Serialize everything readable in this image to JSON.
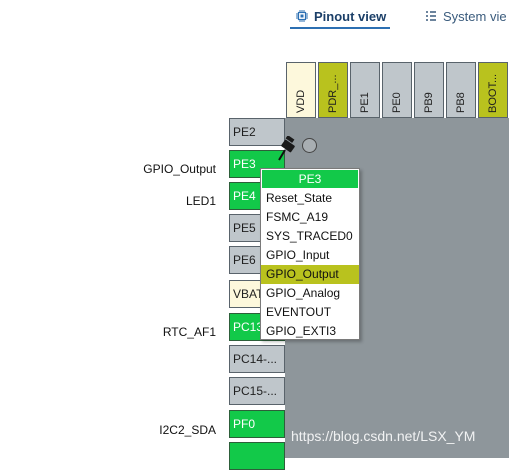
{
  "tabs": {
    "pinout": "Pinout view",
    "system": "System vie"
  },
  "top_pins": [
    {
      "label": "VDD",
      "color": "yellow"
    },
    {
      "label": "PDR_...",
      "color": "olive"
    },
    {
      "label": "PE1",
      "color": "gray"
    },
    {
      "label": "PE0",
      "color": "gray"
    },
    {
      "label": "PB9",
      "color": "gray"
    },
    {
      "label": "PB8",
      "color": "gray"
    },
    {
      "label": "BOOT...",
      "color": "olive"
    }
  ],
  "left_pins": [
    {
      "label": "PE2",
      "color": "gray"
    },
    {
      "label": "PE3",
      "color": "green"
    },
    {
      "label": "PE4",
      "color": "green"
    },
    {
      "label": "PE5",
      "color": "gray"
    },
    {
      "label": "PE6",
      "color": "gray"
    },
    {
      "label": "VBAT",
      "color": "yellow"
    },
    {
      "label": "PC13",
      "color": "green"
    },
    {
      "label": "PC14-...",
      "color": "gray"
    },
    {
      "label": "PC15-...",
      "color": "gray"
    },
    {
      "label": "PF0",
      "color": "green"
    },
    {
      "label": "",
      "color": "green"
    }
  ],
  "signals": {
    "gpio_output": "GPIO_Output",
    "led1": "LED1",
    "rtc_af1": "RTC_AF1",
    "i2c2_sda": "I2C2_SDA"
  },
  "popup": {
    "title": "PE3",
    "items": [
      "Reset_State",
      "FSMC_A19",
      "SYS_TRACED0",
      "GPIO_Input",
      "GPIO_Output",
      "GPIO_Analog",
      "EVENTOUT",
      "GPIO_EXTI3"
    ],
    "selected": "GPIO_Output"
  },
  "watermark": "https://blog.csdn.net/LSX_YM",
  "colors": {
    "green": "#12c949",
    "olive": "#b9c21e",
    "gray": "#bfc6cb",
    "yellow": "#fdf8dc",
    "chip": "#8e969b"
  }
}
